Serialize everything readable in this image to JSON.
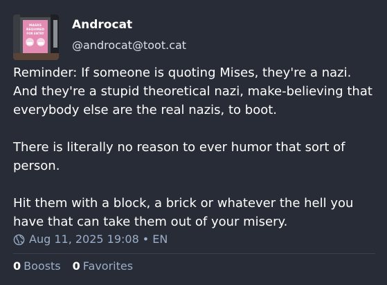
{
  "post": {
    "author": {
      "display_name": "Androcat",
      "handle": "@androcat@toot.cat",
      "avatar_icon": "avatar-sign-photo",
      "avatar_sign_text": "MASKS\nREQUIRED\nFOR ENTRY"
    },
    "content": {
      "paragraphs": [
        "Reminder: If someone is quoting Mises, they're a nazi.\nAnd they're a stupid theoretical nazi, make-believing that everybody else are the real nazis, to boot.",
        "There is literally no reason to ever humor that sort of person.",
        "Hit them with a block, a brick or whatever the hell you have that can take them out of your misery."
      ]
    },
    "meta": {
      "visibility_icon": "globe-icon",
      "timestamp": "Aug 11, 2025 19:08",
      "separator": "•",
      "language": "EN"
    },
    "stats": {
      "boosts_count": "0",
      "boosts_label": "Boosts",
      "favorites_count": "0",
      "favorites_label": "Favorites"
    }
  },
  "colors": {
    "background": "#282c37",
    "text_primary": "#ffffff",
    "text_secondary": "#9baec8",
    "divider": "#3c4050",
    "avatar_sign_pink": "#e48bb3"
  }
}
